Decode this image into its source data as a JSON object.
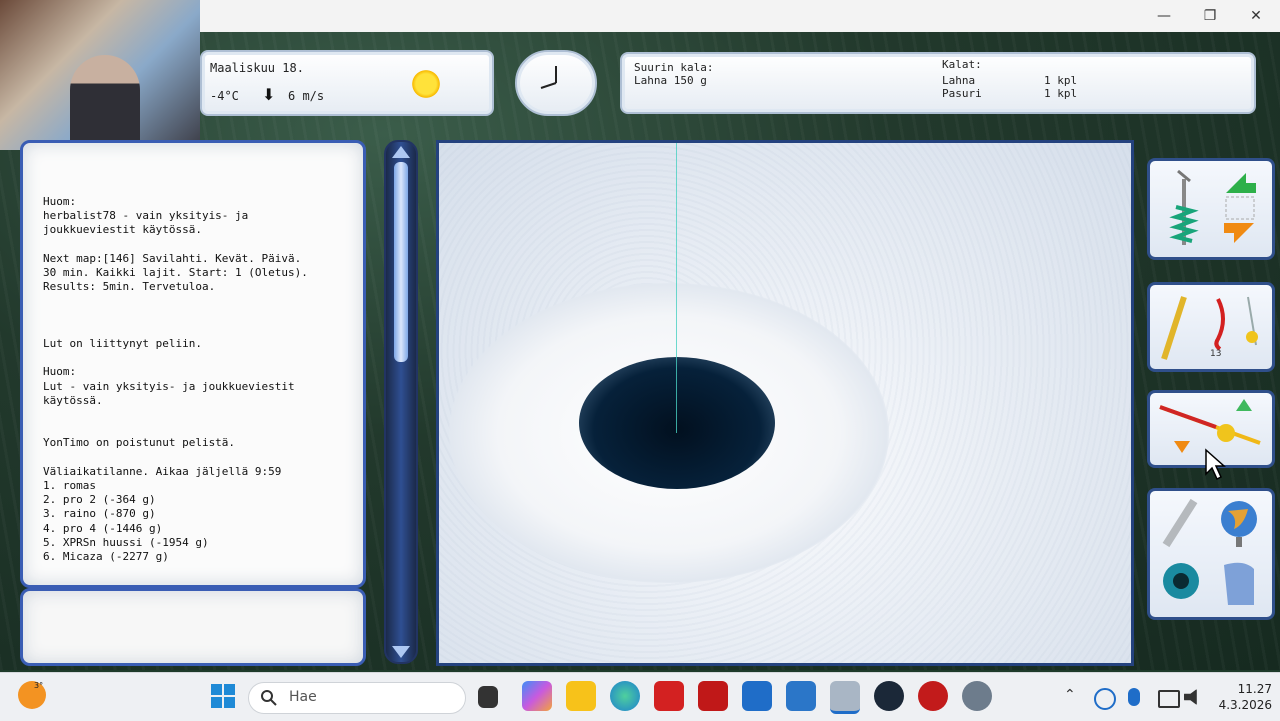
{
  "window": {
    "minimize_label": "—",
    "restore_label": "❐",
    "close_label": "✕"
  },
  "weather": {
    "date": "Maaliskuu 18.",
    "temperature": "-4°C",
    "wind_arrow": "⬇",
    "wind_speed": "6 m/s"
  },
  "biggest_catch": {
    "title": "Suurin kala:",
    "value": "Lahna 150 g"
  },
  "catch_list": {
    "title": "Kalat:",
    "rows": [
      {
        "species": "Lahna",
        "count": "1 kpl"
      },
      {
        "species": "Pasuri",
        "count": "1 kpl"
      }
    ]
  },
  "messages": [
    "Huom:",
    "herbalist78 - vain yksityis- ja",
    "joukkueviestit käytössä.",
    "",
    "Next map:[146] Savilahti. Kevät. Päivä.",
    "30 min. Kaikki lajit. Start: 1 (Oletus).",
    "Results: 5min. Tervetuloa.",
    "",
    "",
    "",
    "Lut on liittynyt peliin.",
    "",
    "Huom:",
    "Lut - vain yksityis- ja joukkueviestit",
    "käytössä.",
    "",
    "",
    "YonTimo on poistunut pelistä.",
    "",
    "Väliaikatilanne. Aikaa jäljellä 9:59",
    "1. romas",
    "2. pro 2 (-364 g)",
    "3. raino (-870 g)",
    "4. pro 4 (-1446 g)",
    "5. XPRSn huussi (-1954 g)",
    "6. Micaza (-2277 g)"
  ],
  "tool_badge": "13",
  "taskbar": {
    "search_placeholder": "Hae",
    "time": "11.27",
    "date": "4.3.2026",
    "weather_badge": "3°"
  },
  "colors": {
    "panel_border": "#3a5db4",
    "ice": "#e8edf4",
    "hole": "#06213a",
    "fishing_line": "#49d0c2"
  }
}
